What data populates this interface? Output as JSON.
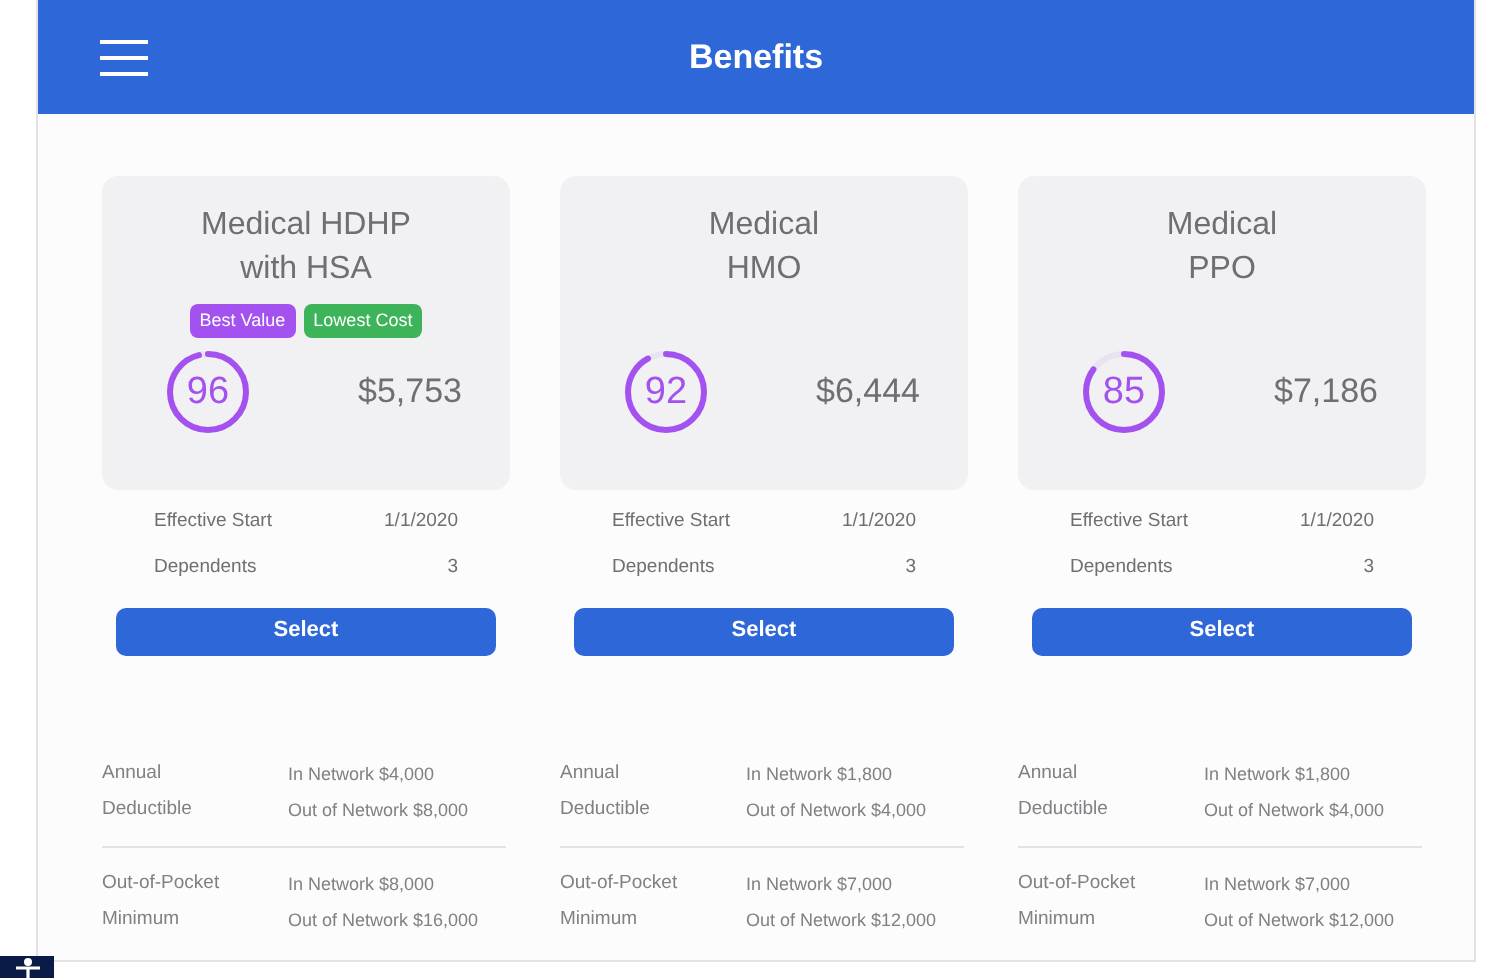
{
  "header": {
    "title": "Benefits"
  },
  "plans": [
    {
      "name_lines": [
        "Medical HDHP",
        "with HSA"
      ],
      "tags": [
        {
          "label": "Best Value",
          "color": "#a352f0"
        },
        {
          "label": "Lowest Cost",
          "color": "#3db35a"
        }
      ],
      "score": "96",
      "cost": "$5,753",
      "details": [
        {
          "label": "Effective Start",
          "value": "1/1/2020"
        },
        {
          "label": "Dependents",
          "value": "3"
        }
      ],
      "button": "Select",
      "costs": [
        {
          "label_lines": [
            "Annual",
            "Deductible"
          ],
          "value_lines": [
            "In Network $4,000",
            "Out of Network $8,000"
          ]
        },
        {
          "label_lines": [
            "Out-of-Pocket",
            "Minimum"
          ],
          "value_lines": [
            "In Network $8,000",
            "Out of Network $16,000"
          ]
        }
      ]
    },
    {
      "name_lines": [
        "Medical",
        "HMO"
      ],
      "score": "92",
      "cost": "$6,444",
      "details": [
        {
          "label": "Effective Start",
          "value": "1/1/2020"
        },
        {
          "label": "Dependents",
          "value": "3"
        }
      ],
      "button": "Select",
      "costs": [
        {
          "label_lines": [
            "Annual",
            "Deductible"
          ],
          "value_lines": [
            "In Network $1,800",
            "Out of Network $4,000"
          ]
        },
        {
          "label_lines": [
            "Out-of-Pocket",
            "Minimum"
          ],
          "value_lines": [
            "In Network $7,000",
            "Out of Network $12,000"
          ]
        }
      ]
    },
    {
      "name_lines": [
        "Medical",
        "PPO"
      ],
      "score": "85",
      "cost": "$7,186",
      "details": [
        {
          "label": "Effective Start",
          "value": "1/1/2020"
        },
        {
          "label": "Dependents",
          "value": "3"
        }
      ],
      "button": "Select",
      "costs": [
        {
          "label_lines": [
            "Annual",
            "Deductible"
          ],
          "value_lines": [
            "In Network $1,800",
            "Out of Network $4,000"
          ]
        },
        {
          "label_lines": [
            "Out-of-Pocket",
            "Minimum"
          ],
          "value_lines": [
            "In Network $7,000",
            "Out of Network $12,000"
          ]
        }
      ]
    }
  ]
}
